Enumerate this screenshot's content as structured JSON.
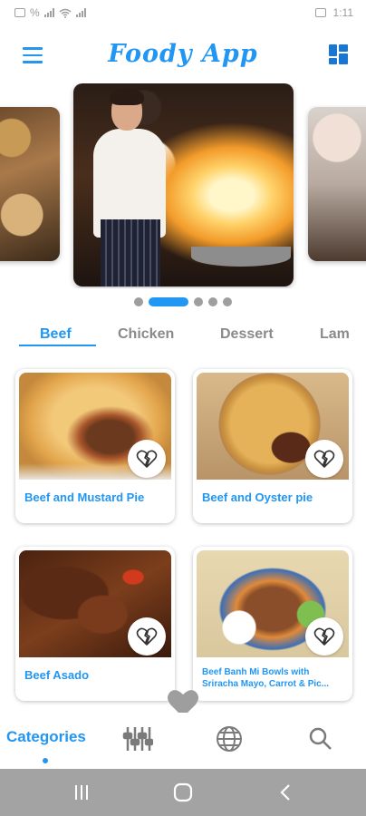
{
  "status_bar": {
    "left_text": "%",
    "right_text": "1:11"
  },
  "app_bar": {
    "title": "Foody App",
    "menu_icon": "menu-icon",
    "layout_icon": "grid-view-icon",
    "accent_color": "#2196F3"
  },
  "carousel": {
    "slides": [
      {
        "subject": "food platter"
      },
      {
        "subject": "chef flambe cooking"
      },
      {
        "subject": "chef plating"
      }
    ],
    "indicator_count": 5,
    "active_index": 1
  },
  "tabs": [
    {
      "label": "Beef"
    },
    {
      "label": "Chicken"
    },
    {
      "label": "Dessert"
    },
    {
      "label": "Lam"
    }
  ],
  "cards": [
    {
      "title": "Beef and Mustard Pie"
    },
    {
      "title": "Beef and Oyster pie"
    },
    {
      "title": "Beef Asado"
    },
    {
      "title_line1": "Beef Banh Mi Bowls with",
      "title_line2": "Sriracha Mayo, Carrot & Pic..."
    }
  ],
  "bottom_nav": {
    "categories_label": "Categories",
    "icons": [
      "ingredients-icon",
      "globe-icon",
      "search-icon"
    ],
    "favorites_icon": "heart-icon"
  }
}
